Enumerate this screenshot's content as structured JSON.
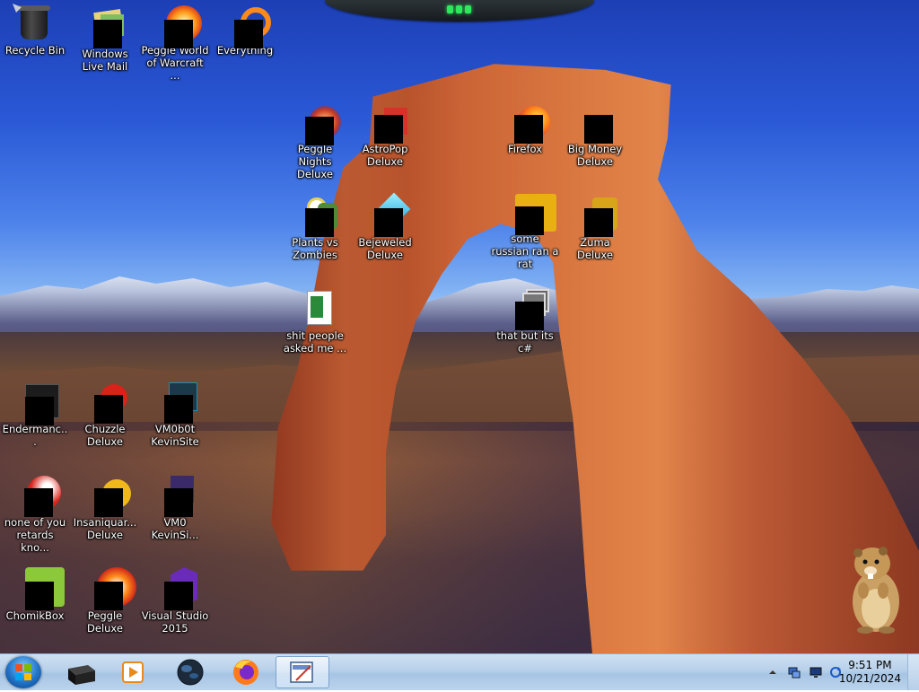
{
  "desktop": {
    "icons": [
      {
        "label": "Recycle Bin",
        "name": "recycle-bin-icon"
      },
      {
        "label": "Windows Live Mail",
        "name": "windows-live-mail-icon"
      },
      {
        "label": "Peggle World of Warcraft ...",
        "name": "peggle-wow-icon"
      },
      {
        "label": "Everything",
        "name": "everything-icon"
      },
      {
        "label": "Peggle Nights Deluxe",
        "name": "peggle-nights-icon"
      },
      {
        "label": "AstroPop Deluxe",
        "name": "astropop-icon"
      },
      {
        "label": "Firefox",
        "name": "firefox-icon"
      },
      {
        "label": "Big Money Deluxe",
        "name": "big-money-icon"
      },
      {
        "label": "Plants vs Zombies",
        "name": "plants-vs-zombies-icon"
      },
      {
        "label": "Bejeweled Deluxe",
        "name": "bejeweled-icon"
      },
      {
        "label": "some russian ran a rat",
        "name": "ie-icon"
      },
      {
        "label": "Zuma Deluxe",
        "name": "zuma-icon"
      },
      {
        "label": "shit people asked me ...",
        "name": "document-icon"
      },
      {
        "label": "that but its c#",
        "name": "stacked-windows-icon"
      },
      {
        "label": "Endermanc...",
        "name": "enderman-app-icon"
      },
      {
        "label": "Chuzzle Deluxe",
        "name": "chuzzle-icon"
      },
      {
        "label": "VM0b0t KevinSite",
        "name": "vm-kevinsite-icon"
      },
      {
        "label": "none of you retards kno...",
        "name": "red-ball-icon"
      },
      {
        "label": "Insaniquar... Deluxe",
        "name": "insaniquarium-icon"
      },
      {
        "label": "VM0 KevinSi...",
        "name": "vm0-kevinsite-icon"
      },
      {
        "label": "ChomikBox",
        "name": "chomikbox-icon"
      },
      {
        "label": "Peggle Deluxe",
        "name": "peggle-deluxe-icon"
      },
      {
        "label": "Visual Studio 2015",
        "name": "visual-studio-icon"
      }
    ]
  },
  "taskbar": {
    "start_label": "Start",
    "pinned": [
      {
        "name": "taskbar-terminal-app",
        "icon": "black-box-icon"
      },
      {
        "name": "taskbar-media-player",
        "icon": "media-player-icon"
      },
      {
        "name": "taskbar-globe-app",
        "icon": "dark-globe-icon"
      },
      {
        "name": "taskbar-firefox",
        "icon": "firefox-icon"
      },
      {
        "name": "taskbar-paint-app",
        "icon": "paint-icon",
        "active": true
      }
    ],
    "tray": {
      "time": "9:51 PM",
      "date": "10/21/2024",
      "icons": [
        "chevron-up-icon",
        "network-icon",
        "display-icon",
        "sync-icon"
      ]
    }
  }
}
